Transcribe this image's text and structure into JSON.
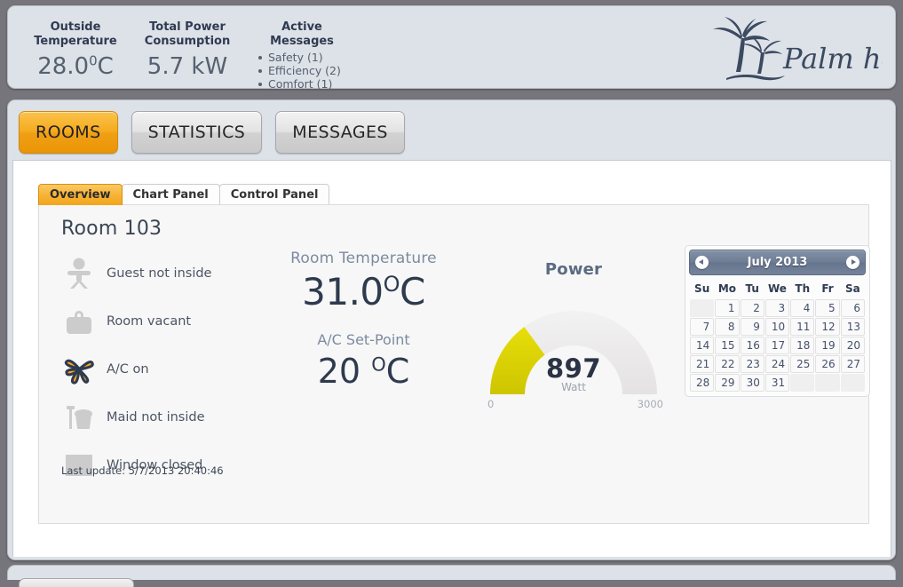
{
  "top_bar": {
    "outside_temperature": {
      "title_line1": "Outside",
      "title_line2": "Temperature",
      "value": "28.0",
      "unit_sup": "0",
      "unit": "C"
    },
    "total_power": {
      "title_line1": "Total Power",
      "title_line2": "Consumption",
      "value": "5.7 kW"
    },
    "active_messages": {
      "title_line1": "Active",
      "title_line2": "Messages",
      "items": [
        "Safety (1)",
        "Efficiency (2)",
        "Comfort (1)"
      ]
    },
    "logo": {
      "text": "Palm hotel",
      "icon": "palm-tree-icon"
    }
  },
  "main_tabs": [
    {
      "label": "ROOMS",
      "active": true
    },
    {
      "label": "STATISTICS",
      "active": false
    },
    {
      "label": "MESSAGES",
      "active": false
    }
  ],
  "sub_tabs": [
    {
      "label": "Overview",
      "active": true
    },
    {
      "label": "Chart Panel",
      "active": false
    },
    {
      "label": "Control Panel",
      "active": false
    }
  ],
  "room": {
    "title": "Room 103",
    "statuses": [
      {
        "icon": "person-icon",
        "label": "Guest not inside",
        "state": "inactive"
      },
      {
        "icon": "suitcase-icon",
        "label": "Room vacant",
        "state": "inactive"
      },
      {
        "icon": "fan-icon",
        "label": "A/C on",
        "state": "active"
      },
      {
        "icon": "bucket-icon",
        "label": "Maid not inside",
        "state": "inactive"
      },
      {
        "icon": "window-icon",
        "label": "Window closed",
        "state": "inactive"
      }
    ],
    "last_update": "Last update: 5/7/2013 20:40:46"
  },
  "temperature": {
    "room_caption": "Room Temperature",
    "room_value": "31.0",
    "room_unit_sup": "O",
    "room_unit": "C",
    "setpoint_caption": "A/C Set-Point",
    "setpoint_value": "20",
    "setpoint_unit_sup": "O",
    "setpoint_unit": "C"
  },
  "chart_data": {
    "type": "gauge",
    "title": "Power",
    "value": 897,
    "unit": "Watt",
    "min": 0,
    "max": 3000,
    "min_label": "0",
    "max_label": "3000",
    "value_label": "897",
    "fill_color": "#dfd500",
    "track_color": "#eceaea",
    "fraction": 0.299
  },
  "calendar": {
    "title": "July 2013",
    "prev_icon": "chevron-left-icon",
    "next_icon": "chevron-right-icon",
    "weekdays": [
      "Su",
      "Mo",
      "Tu",
      "We",
      "Th",
      "Fr",
      "Sa"
    ],
    "weeks": [
      [
        "",
        "1",
        "2",
        "3",
        "4",
        "5",
        "6"
      ],
      [
        "7",
        "8",
        "9",
        "10",
        "11",
        "12",
        "13"
      ],
      [
        "14",
        "15",
        "16",
        "17",
        "18",
        "19",
        "20"
      ],
      [
        "21",
        "22",
        "23",
        "24",
        "25",
        "26",
        "27"
      ],
      [
        "28",
        "29",
        "30",
        "31",
        "",
        "",
        ""
      ]
    ]
  },
  "colors": {
    "accent_orange": "#f2a51c",
    "gauge_yellow": "#dfd500",
    "panel_gray": "#dde1e8",
    "page_background": "#75757b",
    "text_dark": "#2e3a4e"
  }
}
